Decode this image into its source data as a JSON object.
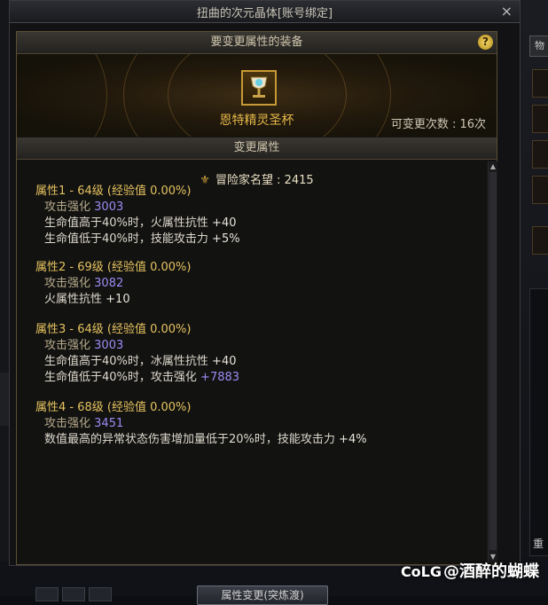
{
  "window": {
    "title": "扭曲的次元晶体[账号绑定]",
    "close_label": "×"
  },
  "equip_section": {
    "header": "要变更属性的装备",
    "help_label": "?",
    "item_name": "恩特精灵圣杯",
    "changes_remaining": "可变更次数 : 16次"
  },
  "change_section": {
    "header": "变更属性"
  },
  "reputation": {
    "label": "冒险家名望 : 2415",
    "icon": "reputation-crest-icon"
  },
  "attributes": [
    {
      "title": "属性1 - 64级 (经验值 0.00%)",
      "base_label": "攻击强化",
      "base_value": "3003",
      "effects": [
        {
          "text": "生命值高于40%时，火属性抗性",
          "value": "+40",
          "value_color": "white"
        },
        {
          "text": "生命值低于40%时，技能攻击力",
          "value": "+5%",
          "value_color": "white"
        }
      ]
    },
    {
      "title": "属性2 - 69级 (经验值 0.00%)",
      "base_label": "攻击强化",
      "base_value": "3082",
      "effects": [
        {
          "text": "火属性抗性",
          "value": "+10",
          "value_color": "white"
        }
      ]
    },
    {
      "title": "属性3 - 64级 (经验值 0.00%)",
      "base_label": "攻击强化",
      "base_value": "3003",
      "effects": [
        {
          "text": "生命值高于40%时，冰属性抗性",
          "value": "+40",
          "value_color": "white"
        },
        {
          "text": "生命值低于40%时，攻击强化",
          "value": "+7883",
          "value_color": "blue"
        }
      ]
    },
    {
      "title": "属性4 - 68级 (经验值 0.00%)",
      "base_label": "攻击强化",
      "base_value": "3451",
      "effects": [
        {
          "text": "数值最高的异常状态伤害增加量低于20%时，技能攻击力",
          "value": "+4%",
          "value_color": "white"
        }
      ]
    }
  ],
  "background": {
    "right_tab_label": "物",
    "bottom_button_label": "属性变更(突炼渡)",
    "right_bottom_label": "重"
  },
  "watermark": {
    "logo": "CoLG",
    "text": "@酒醉的蝴蝶"
  },
  "colors": {
    "gold_title": "#e5c25f",
    "blue_value": "#9a8cf2",
    "item_name": "#e6b84a"
  }
}
